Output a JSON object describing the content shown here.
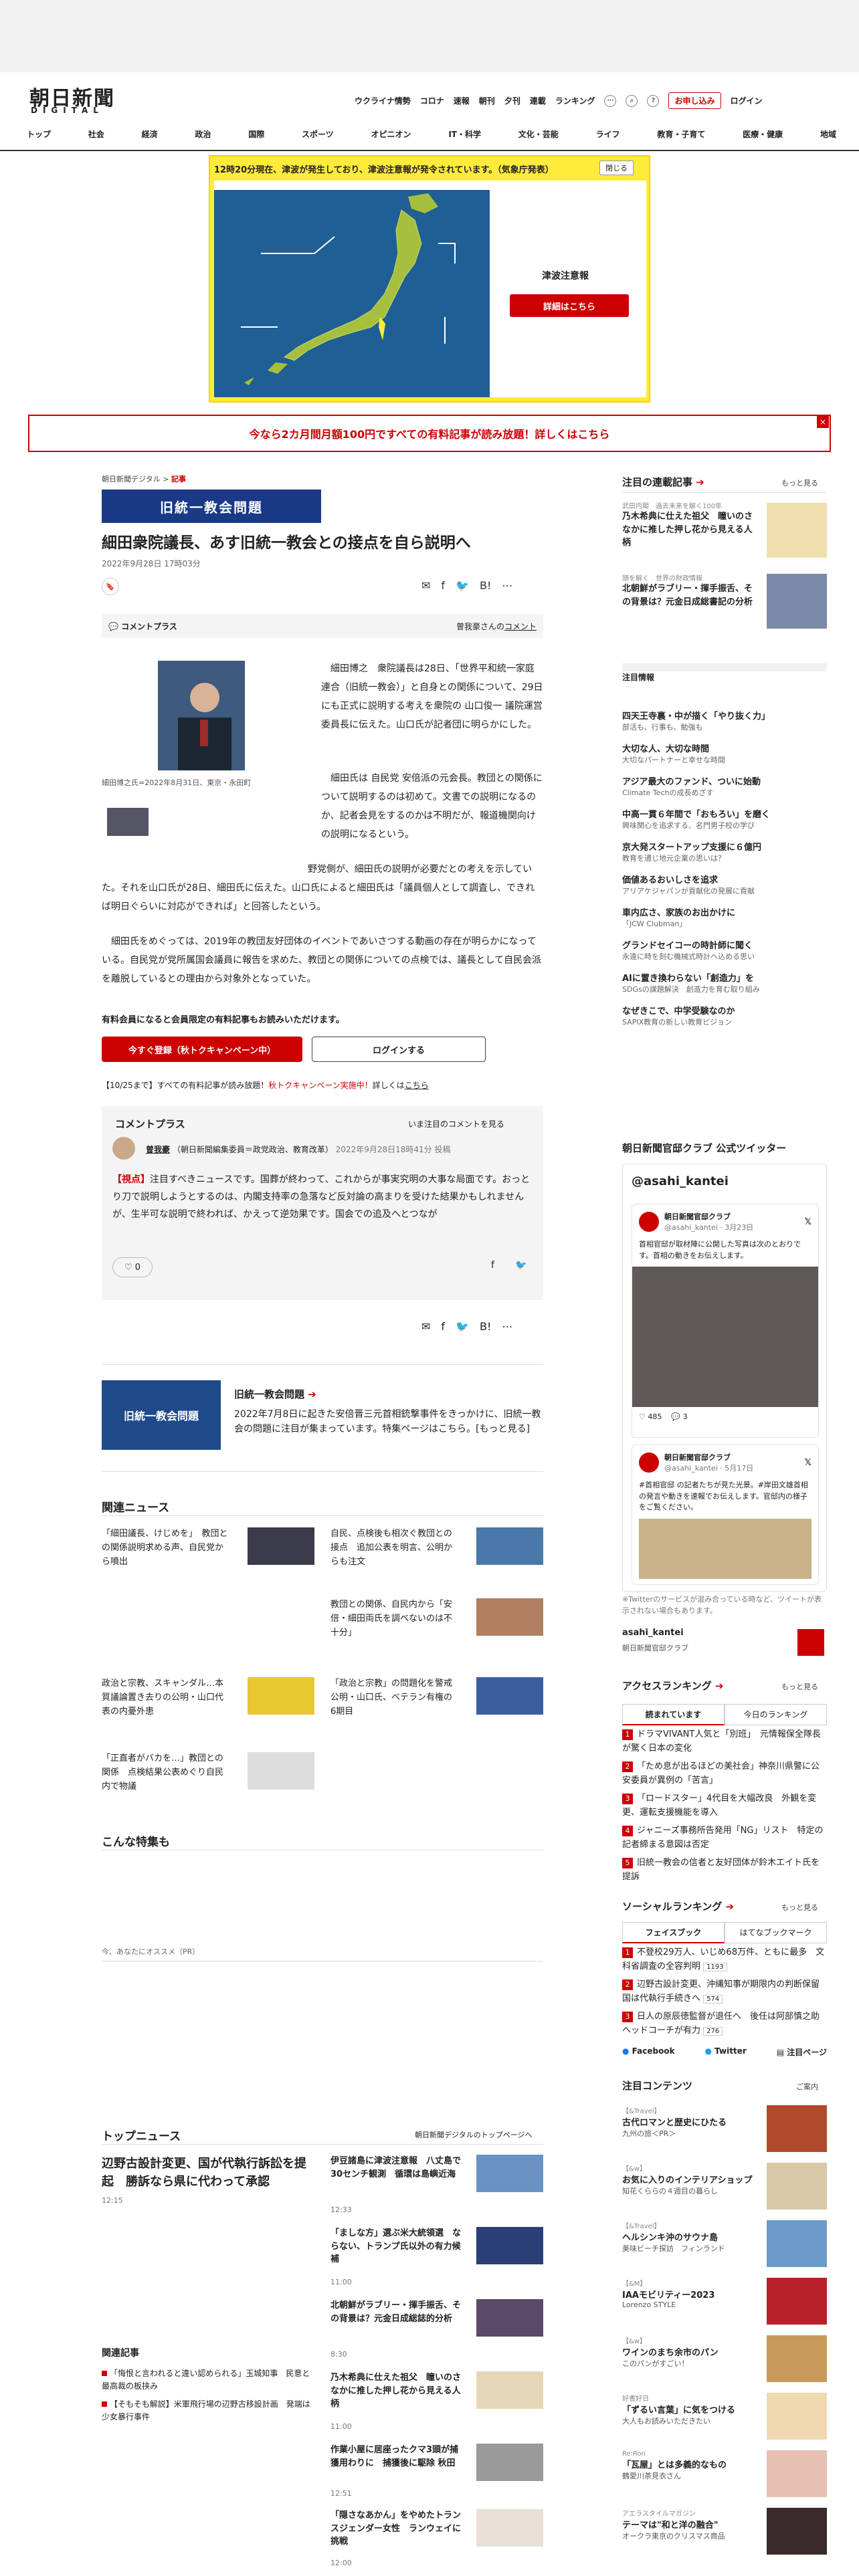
{
  "header": {
    "logo": "朝日新聞",
    "logo_sub": "DIGITAL",
    "topnav": [
      "ウクライナ情勢",
      "コロナ",
      "速報",
      "朝刊",
      "夕刊",
      "連載",
      "ランキング"
    ],
    "subscribe": "お申し込み",
    "login": "ログイン",
    "categories": [
      "トップ",
      "社会",
      "経済",
      "政治",
      "国際",
      "スポーツ",
      "オピニオン",
      "IT・科学",
      "文化・芸能",
      "ライフ",
      "教育・子育て",
      "医療・健康",
      "地域"
    ]
  },
  "alert": {
    "title": "12時20分現在、津波が発生しており、津波注意報が発令されています。（気象庁発表）",
    "close": "閉じる",
    "label": "津波注意報",
    "button": "詳細はこちら"
  },
  "promo": {
    "text": "今なら2カ月間月額100円ですべての有料記事が読み放題！詳しくはこちら",
    "close": "×"
  },
  "article": {
    "breadcrumb_home": "朝日新聞デジタル",
    "breadcrumb_sep": ">",
    "breadcrumb_current": "記事",
    "tag": "旧統一教会問題",
    "title": "細田衆院議長、あす旧統一教会との接点を自ら説明へ",
    "date": "2022年9月28日 17時03分",
    "comment_plus": "コメントプラス",
    "commenter_note": "曽我豪さんの",
    "commenter_link": "コメント",
    "photo_caption": "細田博之氏=2022年8月31日、東京・永田町",
    "para1": "細田博之　衆院議長は28日、「世界平和統一家庭連合（旧統一教会）」と自身との関係について、29日にも正式に説明する考えを衆院の 山口俊一 議院運営委員長に伝えた。山口氏が記者団に明らかにした。",
    "para2": "細田氏は 自民党 安倍派の元会長。教団との関係について説明するのは初めて。文書での説明になるのか、記者会見をするのかは不明だが、報道機関向けの説明になるという。",
    "para3": "野党側が、細田氏の説明が必要だとの考えを示していた。それを山口氏が28日、細田氏に伝えた。山口氏によると細田氏は「議員個人として調査し、できれば明日ぐらいに対応ができれば」と回答したという。",
    "para4": "細田氏をめぐっては、2019年の教団友好団体のイベントであいさつする動画の存在が明らかになっている。自民党が党所属国会議員に報告を求めた、教団との関係についての点検では、議長として自民会派を離脱しているとの理由から対象外となっていた。",
    "member_note": "有料会員になると会員限定の有料記事もお読みいただけます。",
    "register": "今すぐ登録（秋トクキャンペーン中）",
    "login": "ログインする",
    "campaign_pre": "【10/25まで】すべての有料記事が読み放題！",
    "campaign_red": "秋トクキャンペーン実施中！",
    "campaign_post": "詳しくは",
    "campaign_link": "こちら"
  },
  "comment_box": {
    "title": "コメントプラス",
    "see_all": "いま注目のコメントを見る",
    "name": "曽我豪",
    "role": "（朝日新聞編集委員＝政党政治、教育改革）",
    "time": "2022年9月28日18時41分 投稿",
    "tag": "【視点】",
    "text": "注目すべきニュースです。国葬が終わって、これからが事実究明の大事な局面です。おっとり刀で説明しようとするのは、内閣支持率の急落など反対論の高まりを受けた結果かもしれませんが、生半可な説明で終われば、かえって逆効果です。国会での追及へとつなが",
    "likes": "0"
  },
  "feature": {
    "image_label": "旧統一教会問題",
    "title": "旧統一教会問題",
    "desc": "2022年7月8日に起きた安倍晋三元首相銃撃事件をきっかけに、旧統一教会の問題に注目が集まっています。特集ページはこちら。",
    "more": "[もっと見る]"
  },
  "related": {
    "title": "関連ニュース",
    "items": [
      "「細田議長、けじめを」　教団との関係説明求める声、自民党から噴出",
      "自民、点検後も相次ぐ教団との接点　追加公表を明言、公明からも注文",
      "教団との関係、自民内から「安倍・細田両氏を調べないのは不十分」",
      "政治と宗教、スキャンダル…本質議論置き去りの公明・山口代表の内憂外患",
      "「政治と宗教」の問題化を警戒　公明・山口氏、ベテラン有権の6期目",
      "「正直者がバカを…」教団との関係　点検結果公表めぐり自民内で物議"
    ],
    "konna_title": "こんな特集も",
    "recommend": "今、あなたにオススメ（PR）"
  },
  "top_news": {
    "title": "トップニュース",
    "link": "朝日新聞デジタルのトップページへ",
    "lead_title": "辺野古設計変更、国が代執行訴訟を提起　勝訴なら県に代わって承認",
    "lead_time": "12:15",
    "related_title": "関連記事",
    "related_items": [
      "「悔恨と言われると違い認められる」玉城知事　民意と最高裁の板挟み",
      "【そもそも解説】米軍飛行場の辺野古移設計画　発端は少女暴行事件"
    ],
    "items": [
      {
        "title": "伊豆諸島に津波注意報　八丈島で30センチ観測　循環は島嶼近海",
        "time": "12:33"
      },
      {
        "title": "「ましな方」選ぶ米大統領選　ならない、トランプ氏以外の有力候補",
        "time": "11:00"
      },
      {
        "title": "北朝鮮がラブリー・揮手振舌、その背景は？元金日成総誌的分析",
        "time": "8:30"
      },
      {
        "title": "乃木希典に仕えた祖父　瞳いのさなかに推した押し花から見える人柄",
        "time": "11:00"
      },
      {
        "title": "作業小屋に居座ったクマ3頭が捕獲用わりに　捕獲後に駆除 秋田",
        "time": "12:51"
      },
      {
        "title": "「隠さなあかん」をやめたトランスジェンダー女性　ランウェイに挑戦",
        "time": "12:00"
      }
    ]
  },
  "sidebar": {
    "series_title": "注目の連載記事",
    "more": "もっと見る",
    "series_items": [
      {
        "label": "武田内閣　過去未来を解く100年",
        "title": "乃木希典に仕えた祖父　瞳いのさなかに推した押し花から見える人柄"
      },
      {
        "label": "頭を解く　世界の財政情報",
        "title": "北朝鮮がラブリー・揮手振舌、その背景は？元金日成総書記の分析"
      }
    ],
    "notice_title": "注目情報",
    "notice_items": [
      {
        "title": "四天王寺裏・中が描く「やり抜く力」",
        "sub": "部活も、行事も、勉強も"
      },
      {
        "title": "大切な人、大切な時間",
        "sub": "大切なパートナーと幸せな時間"
      },
      {
        "title": "アジア最大のファンド、ついに始動",
        "sub": "Climate Techの成長めざす"
      },
      {
        "title": "中高一貫６年間で「おもろい」を磨く",
        "sub": "興味関心を追求する、名門男子校の学び"
      },
      {
        "title": "京大発スタートアップ支援に６億円",
        "sub": "教育を通じ地元企業の思いは？"
      },
      {
        "title": "価値あるおいしさを追求",
        "sub": "アリアケジャパンが貢献化の発展に貢献"
      },
      {
        "title": "車内広さ、家族のお出かけに",
        "sub": "「JCW Clubman」"
      },
      {
        "title": "グランドセイコーの時計師に聞く",
        "sub": "永遠に時を刻む機械式時計へ込める思い"
      },
      {
        "title": "AIに置き換わらない「創造力」を",
        "sub": "SDGsの課題解決　創造力を育む取り組み"
      },
      {
        "title": "なぜきこで、中学受験なのか",
        "sub": "SAPIX教育の新しい教育ビジョン"
      }
    ],
    "twitter_title": "朝日新聞官邸クラブ 公式ツイッター",
    "twitter_handle": "@asahi_kantei",
    "tweets": [
      {
        "name": "朝日新聞官邸クラブ",
        "handle": "@asahi_kantei · 3月23日",
        "text": "首相官邸が取材陣に公開した写真は次のとおりです。首相の動きをお伝えします。",
        "likes": "485",
        "replies": "3"
      },
      {
        "name": "朝日新聞官邸クラブ",
        "handle": "@asahi_kantei · 5月17日",
        "text": "#首相官邸 の記者たちが見た光景。#岸田文雄首相の発言や動きを速報でお伝えします。官邸内の様子をご覧ください。"
      }
    ],
    "tw_note": "※Twitterのサービスが混み合っている時など、ツイートが表示されない場合もあります。",
    "tw_account": "asahi_kantei",
    "tw_account_sub": "朝日新聞官邸クラブ",
    "ranking_title": "アクセスランキング",
    "ranking_tabs": [
      "読まれています",
      "今日のランキング"
    ],
    "ranking_items": [
      "ドラマVIVANT人気と「別班」　元情報保全隊長が驚く日本の変化",
      "「ため息が出るほどの美社会」神奈川県警に公安委員が異例の「苦言」",
      "「ロードスター」4代目を大幅改良　外観を変更、運転支援機能を導入",
      "ジャニーズ事務所告発用「NG」リスト　特定の記者締まる意図は否定",
      "旧統一教会の信者と友好団体が鈴木エイト氏を提訴"
    ],
    "social_title": "ソーシャルランキング",
    "social_tabs": [
      "フェイスブック",
      "はてなブックマーク"
    ],
    "social_items": [
      {
        "title": "不登校29万人、いじめ68万件、ともに最多　文科省調査の全容判明",
        "count": "1193"
      },
      {
        "title": "辺野古設計変更、沖縄知事が期限内の判断保留　国は代執行手続きへ",
        "count": "574"
      },
      {
        "title": "日人の原辰徳監督が退任へ　後任は阿部慎之助ヘッドコーチが有力",
        "count": "276"
      }
    ],
    "social_links": [
      "Facebook",
      "Twitter",
      "注目ページ"
    ],
    "content_title": "注目コンテンツ",
    "content_more": "ご案内",
    "content_items": [
      {
        "label": "【&Travel】",
        "title": "古代ロマンと歴史にひたる",
        "sub": "九州の旅＜PR＞"
      },
      {
        "label": "【&w】",
        "title": "お気に入りのインテリアショップ",
        "sub": "知花くららの４週目の暮らし"
      },
      {
        "label": "【&Travel】",
        "title": "ヘルシンキ沖のサウナ島",
        "sub": "美味ビーチ探訪　フィンランド"
      },
      {
        "label": "【&M】",
        "title": "IAAモビリティー2023",
        "sub": "Lorenzo STYLE"
      },
      {
        "label": "【&w】",
        "title": "ワインのまち余市のパン",
        "sub": "このパンがすごい！"
      },
      {
        "label": "好書好日",
        "title": "「ずるい言葉」に気をつける",
        "sub": "大人もお読みいただきたい"
      },
      {
        "label": "Re:Ron",
        "title": "「瓦屋」とは多義的なもの",
        "sub": "鶴愛川茶見衣さん"
      },
      {
        "label": "アエラスタイルマガジン",
        "title": "テーマは\"和と洋の融合\"",
        "sub": "オークラ東京のクリスマス商品"
      }
    ]
  }
}
